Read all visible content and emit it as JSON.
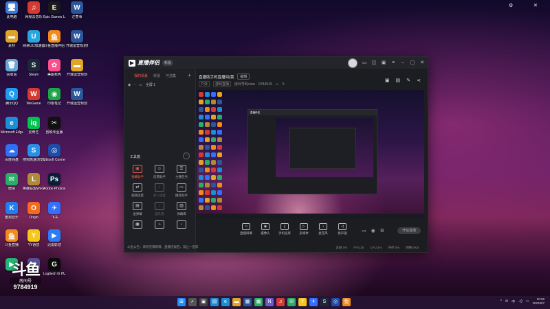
{
  "desktop": {
    "icons": [
      {
        "label": "此电脑",
        "glyph": "🖥",
        "color": "#3a7bd5"
      },
      {
        "label": "网易云音乐",
        "glyph": "♫",
        "color": "#d33a31"
      },
      {
        "label": "Epic Games Launcher",
        "glyph": "E",
        "color": "#1a1a1a"
      },
      {
        "label": "注意事",
        "glyph": "W",
        "color": "#2b579a"
      },
      {
        "label": "素材",
        "glyph": "▬",
        "color": "#e0a526"
      },
      {
        "label": "网易UU加速器",
        "glyph": "U",
        "color": "#2aa6de"
      },
      {
        "label": "斗鱼直播伴侣",
        "glyph": "鱼",
        "color": "#f28b1e"
      },
      {
        "label": "开城运营规划某个关系...",
        "glyph": "W",
        "color": "#2b579a"
      },
      {
        "label": "回收站",
        "glyph": "🗑",
        "color": "#6aa6d8"
      },
      {
        "label": "Steam",
        "glyph": "S",
        "color": "#1b2838"
      },
      {
        "label": "美图秀秀",
        "glyph": "✿",
        "color": "#ff4f8b"
      },
      {
        "label": "开城运营规划",
        "glyph": "▬",
        "color": "#e0a526"
      },
      {
        "label": "腾讯QQ",
        "glyph": "Q",
        "color": "#1d9bf0"
      },
      {
        "label": "WeGame",
        "glyph": "W",
        "color": "#d33a31"
      },
      {
        "label": "印象笔记",
        "glyph": "◉",
        "color": "#20a54a"
      },
      {
        "label": "开城运营规划",
        "glyph": "W",
        "color": "#2b579a"
      },
      {
        "label": "Microsoft Edge",
        "glyph": "e",
        "color": "#1a8fd6"
      },
      {
        "label": "爱奇艺",
        "glyph": "iq",
        "color": "#00c24f"
      },
      {
        "label": "剪映专业版",
        "glyph": "✂",
        "color": "#111111"
      },
      {
        "label": "百度网盘",
        "glyph": "☁",
        "color": "#2e6ff5"
      },
      {
        "label": "搜狗高速浏览器",
        "glyph": "S",
        "color": "#2790e8"
      },
      {
        "label": "Ubisoft Connect",
        "glyph": "◎",
        "color": "#1f4ca8"
      },
      {
        "label": "微信",
        "glyph": "✉",
        "color": "#2aae67"
      },
      {
        "label": "英雄联盟WeGame版",
        "glyph": "L",
        "color": "#b08a38"
      },
      {
        "label": "Adobe Photosh...",
        "glyph": "Ps",
        "color": "#0a1e36"
      },
      {
        "label": "酷狗音乐",
        "glyph": "K",
        "color": "#1f7ef0"
      },
      {
        "label": "Origin",
        "glyph": "O",
        "color": "#f36b21"
      },
      {
        "label": "飞书",
        "glyph": "✈",
        "color": "#3370ff"
      },
      {
        "label": "斗鱼直播",
        "glyph": "鱼",
        "color": "#f28b1e"
      },
      {
        "label": "YY语音",
        "glyph": "Y",
        "color": "#f5c71a"
      },
      {
        "label": "迅雷影音",
        "glyph": "▶",
        "color": "#2b7cf6"
      },
      {
        "label": "",
        "glyph": "▶",
        "color": "#22b573"
      },
      {
        "label": "",
        "glyph": "▦",
        "color": "#5a4e9c"
      },
      {
        "label": "Logitech G HUB",
        "glyph": "G",
        "color": "#0b0b0b"
      }
    ]
  },
  "app": {
    "name": "直播伴侣",
    "version_badge": "新版",
    "tabs": [
      "我的场景",
      "频道",
      "可选集"
    ],
    "scene_label": "全屏 1",
    "room_title": "直播助手的直播间(我",
    "room_edit": "编辑",
    "room_sub_chips": [
      "户外",
      "游戏直播"
    ],
    "room_id_label": "房间号码view",
    "room_id": "9784919",
    "viewers": "0",
    "tools_title": "工具箱",
    "tools": [
      {
        "label": "弹幕助手",
        "glyph": "▣",
        "active": true,
        "dim": false
      },
      {
        "label": "房管助手",
        "glyph": "☺",
        "active": false,
        "dim": false
      },
      {
        "label": "主播任务",
        "glyph": "☰",
        "active": false,
        "dim": false
      },
      {
        "label": "视频连麦",
        "glyph": "⇄",
        "active": false,
        "dim": false
      },
      {
        "label": "多人连麦",
        "glyph": "↓",
        "active": false,
        "dim": true
      },
      {
        "label": "推荐助手",
        "glyph": "▭",
        "active": false,
        "dim": false
      },
      {
        "label": "送弹幕",
        "glyph": "▤",
        "active": false,
        "dim": false
      },
      {
        "label": "送礼物",
        "glyph": "↓",
        "active": false,
        "dim": true
      },
      {
        "label": "弹幕库",
        "glyph": "▥",
        "active": false,
        "dim": false
      },
      {
        "label": "",
        "glyph": "▣",
        "active": false,
        "dim": false
      },
      {
        "label": "",
        "glyph": "⌁",
        "active": false,
        "dim": false
      },
      {
        "label": "",
        "glyph": "↓",
        "active": false,
        "dim": false
      }
    ],
    "left_status": "斗鱼公告：请勿无限制目，直播违规后，禁止一直等",
    "controls": [
      {
        "label": "直播屏幕",
        "glyph": "▭"
      },
      {
        "label": "摄像头",
        "glyph": "◉"
      },
      {
        "label": "手机投屏",
        "glyph": "▯"
      },
      {
        "label": "多媒体",
        "glyph": "▷"
      },
      {
        "label": "麦克风",
        "glyph": "♪"
      },
      {
        "label": "扬声器",
        "glyph": "◁"
      }
    ],
    "start_live": "开始直播",
    "status": [
      "丢帧 0%",
      "FPS:30",
      "CPU:2%",
      "内存:0%",
      "网络:0KB"
    ]
  },
  "watermark": {
    "big": "斗鱼",
    "sub": "房间号",
    "id": "9784919"
  },
  "taskbar": {
    "apps": [
      {
        "name": "start",
        "glyph": "⊞",
        "color": "#1f8fff"
      },
      {
        "name": "search",
        "glyph": "⌕",
        "color": "#555"
      },
      {
        "name": "task-view",
        "glyph": "▣",
        "color": "#444"
      },
      {
        "name": "widgets",
        "glyph": "▤",
        "color": "#1a8fd6"
      },
      {
        "name": "edge",
        "glyph": "e",
        "color": "#1a8fd6"
      },
      {
        "name": "explorer",
        "glyph": "▬",
        "color": "#e0a526"
      },
      {
        "name": "store",
        "glyph": "▦",
        "color": "#2b579a"
      },
      {
        "name": "app",
        "glyph": "▦",
        "color": "#2aae67"
      },
      {
        "name": "notion",
        "glyph": "N",
        "color": "#6a5acd"
      },
      {
        "name": "netease",
        "glyph": "♫",
        "color": "#d33a31"
      },
      {
        "name": "wechat",
        "glyph": "✉",
        "color": "#2aae67"
      },
      {
        "name": "yy",
        "glyph": "Y",
        "color": "#f5c71a"
      },
      {
        "name": "feishu",
        "glyph": "✈",
        "color": "#3370ff"
      },
      {
        "name": "steam",
        "glyph": "S",
        "color": "#1b2838"
      },
      {
        "name": "ubisoft",
        "glyph": "◎",
        "color": "#1f4ca8"
      },
      {
        "name": "douyu",
        "glyph": "鱼",
        "color": "#f28b1e"
      }
    ],
    "tray": [
      "^",
      "✉",
      "中",
      "◁)",
      "▭"
    ],
    "time": "20:06",
    "date": "2022/6/7"
  }
}
